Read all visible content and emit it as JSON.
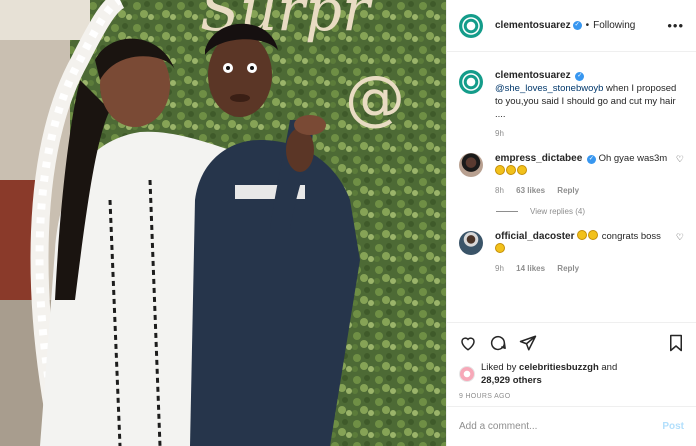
{
  "post": {
    "username": "clementosuarez",
    "follow_status": "Following",
    "more_label": "•••"
  },
  "photo": {
    "sign_text_top": "Surpr",
    "sign_text_at": "@"
  },
  "caption": {
    "username": "clementosuarez",
    "mention": "@she_loves_stonebwoyb",
    "text": " when I proposed to you,you said I should go and cut my hair ....",
    "time": "9h"
  },
  "comments": [
    {
      "username": "empress_dictabee",
      "verified": true,
      "text": "Oh gyae was3m",
      "emoji_count": 3,
      "time": "8h",
      "likes": "63 likes",
      "reply": "Reply",
      "view_replies": "View replies (4)"
    },
    {
      "username": "official_dacoster",
      "verified": false,
      "text": "congrats boss",
      "time": "9h",
      "likes": "14 likes",
      "reply": "Reply"
    }
  ],
  "likes": {
    "prefix": "Liked by ",
    "user": "celebritiesbuzzgh",
    "and": " and",
    "others": "28,929 others"
  },
  "time_ago": "9 HOURS AGO",
  "comment_box": {
    "placeholder": "Add a comment...",
    "post_label": "Post"
  },
  "colors": {
    "link": "#00376b",
    "verified": "#3897f0",
    "muted": "#8e8e8e",
    "post_disabled": "#b2dffc"
  }
}
